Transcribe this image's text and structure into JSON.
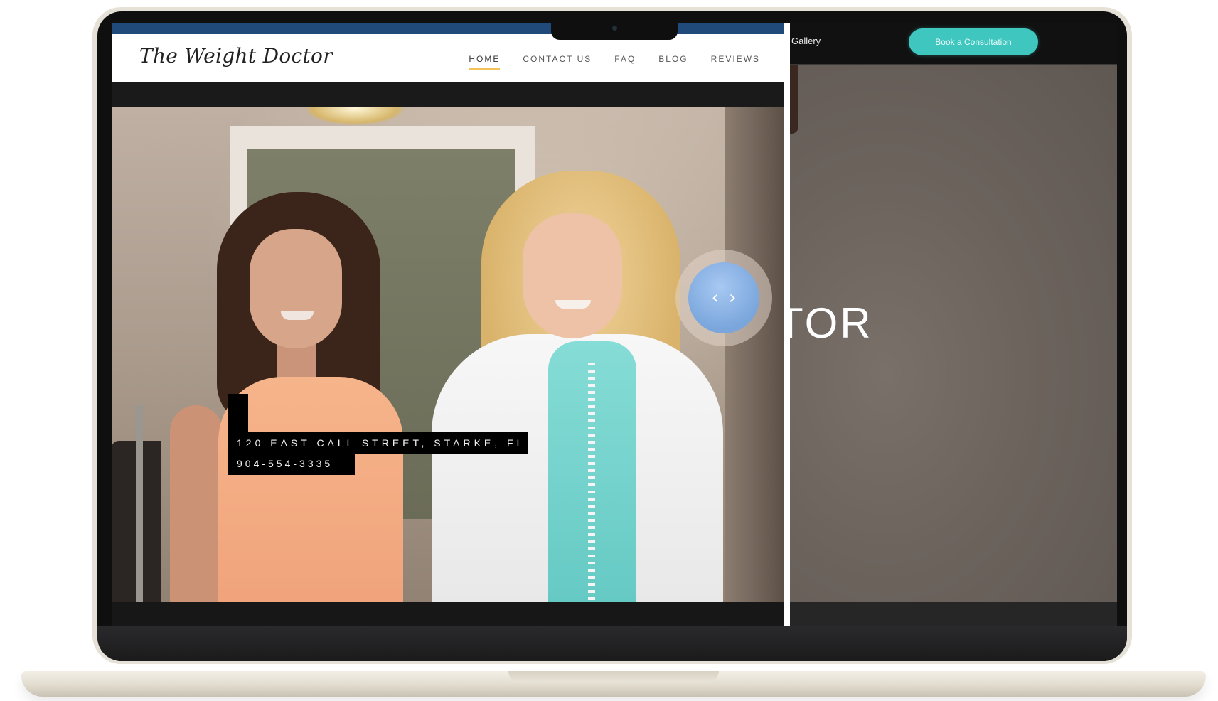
{
  "left_site": {
    "logo": "The Weight Doctor",
    "nav": [
      "HOME",
      "CONTACT US",
      "FAQ",
      "BLOG",
      "REVIEWS"
    ],
    "active_nav": "HOME",
    "address_line1": "120 EAST CALL STREET, STARKE, FL",
    "address_line2": "904-554-3335",
    "colors": {
      "top_accent": "#1f4a7a",
      "nav_underline": "#f3c35a"
    }
  },
  "right_site": {
    "nav_gallery": "Gallery",
    "cta": "Book a Consultation",
    "hero_title_fragment": "TOR",
    "colors": {
      "cta": "#3ec6bf"
    }
  },
  "compare_slider": {
    "left_arrow": "‹",
    "right_arrow": "›",
    "icon": "left-right-arrows-icon"
  }
}
